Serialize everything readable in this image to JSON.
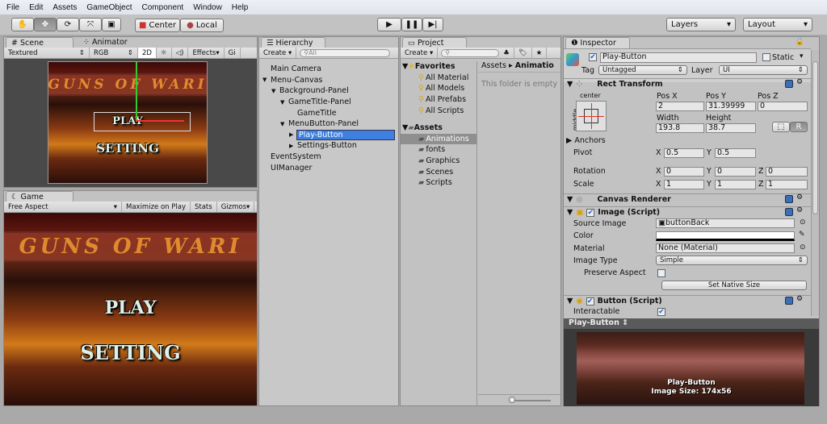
{
  "menu": [
    "File",
    "Edit",
    "Assets",
    "GameObject",
    "Component",
    "Window",
    "Help"
  ],
  "toolbar": {
    "tools": [
      "hand-icon",
      "move-icon",
      "rotate-icon",
      "scale-icon",
      "rect-icon"
    ],
    "pivot": "Center",
    "space": "Local",
    "play_controls": [
      "play-icon",
      "pause-icon",
      "step-icon"
    ],
    "layers": "Layers",
    "layout": "Layout"
  },
  "scene": {
    "tabs": [
      "Scene",
      "Animator"
    ],
    "shading": "Textured",
    "channel": "RGB",
    "mode2d": "2D",
    "effects": "Effects",
    "gizmos": "Gi"
  },
  "game": {
    "tab": "Game",
    "aspect": "Free Aspect",
    "maximize": "Maximize on Play",
    "stats": "Stats",
    "gizmos": "Gizmos",
    "logo_text": "GUNS OF WARI",
    "play_label": "PLAY",
    "setting_label": "SETTING"
  },
  "hierarchy": {
    "tab": "Hierarchy",
    "create": "Create",
    "search_placeholder": "All",
    "items": [
      {
        "label": "Main Camera",
        "depth": 0,
        "arrow": ""
      },
      {
        "label": "Menu-Canvas",
        "depth": 0,
        "arrow": "▼"
      },
      {
        "label": "Background-Panel",
        "depth": 1,
        "arrow": "▼"
      },
      {
        "label": "GameTitle-Panel",
        "depth": 2,
        "arrow": "▼"
      },
      {
        "label": "GameTitle",
        "depth": 3,
        "arrow": ""
      },
      {
        "label": "MenuButton-Panel",
        "depth": 2,
        "arrow": "▼"
      },
      {
        "label": "Play-Button",
        "depth": 3,
        "arrow": "▶",
        "selected": true
      },
      {
        "label": "Settings-Button",
        "depth": 3,
        "arrow": "▶"
      },
      {
        "label": "EventSystem",
        "depth": 0,
        "arrow": ""
      },
      {
        "label": "UIManager",
        "depth": 0,
        "arrow": ""
      }
    ]
  },
  "project": {
    "tab": "Project",
    "create": "Create",
    "favorites_label": "Favorites",
    "favorites": [
      "All Material",
      "All Models",
      "All Prefabs",
      "All Scripts"
    ],
    "assets_label": "Assets",
    "folders": [
      "Animations",
      "fonts",
      "Graphics",
      "Scenes",
      "Scripts"
    ],
    "selected_folder": "Animations",
    "breadcrumb": [
      "Assets",
      "Animatio"
    ],
    "empty_message": "This folder is empty"
  },
  "inspector": {
    "tab": "Inspector",
    "object_name": "Play-Button",
    "static_label": "Static",
    "tag_label": "Tag",
    "tag": "Untagged",
    "layer_label": "Layer",
    "layer": "UI",
    "rect_transform": {
      "title": "Rect Transform",
      "anchor_h": "center",
      "anchor_v": "middle",
      "pos_x_label": "Pos X",
      "pos_y_label": "Pos Y",
      "pos_z_label": "Pos Z",
      "pos_x": "2",
      "pos_y": "31.39999",
      "pos_z": "0",
      "width_label": "Width",
      "height_label": "Height",
      "width": "193.8",
      "height": "38.7",
      "r_button": "R",
      "anchors": "Anchors",
      "pivot_label": "Pivot",
      "pivot_x": "0.5",
      "pivot_y": "0.5",
      "rotation_label": "Rotation",
      "rot_x": "0",
      "rot_y": "0",
      "rot_z": "0",
      "scale_label": "Scale",
      "scale_x": "1",
      "scale_y": "1",
      "scale_z": "1",
      "x": "X",
      "y": "Y",
      "z": "Z"
    },
    "canvas_renderer": "Canvas Renderer",
    "image": {
      "title": "Image (Script)",
      "source_label": "Source Image",
      "source": "buttonBack",
      "color_label": "Color",
      "color": "#ffffff",
      "material_label": "Material",
      "material": "None (Material)",
      "type_label": "Image Type",
      "type": "Simple",
      "preserve_label": "Preserve Aspect",
      "native_size": "Set Native Size"
    },
    "button": {
      "title": "Button (Script)",
      "interactable_label": "Interactable",
      "interactable": true
    },
    "preview": {
      "header": "Play-Button",
      "name": "Play-Button",
      "size": "Image Size: 174x56"
    }
  },
  "colors": {
    "selection": "#3d80df",
    "panel": "#c2c2c2",
    "accent_red": "#e03020"
  }
}
